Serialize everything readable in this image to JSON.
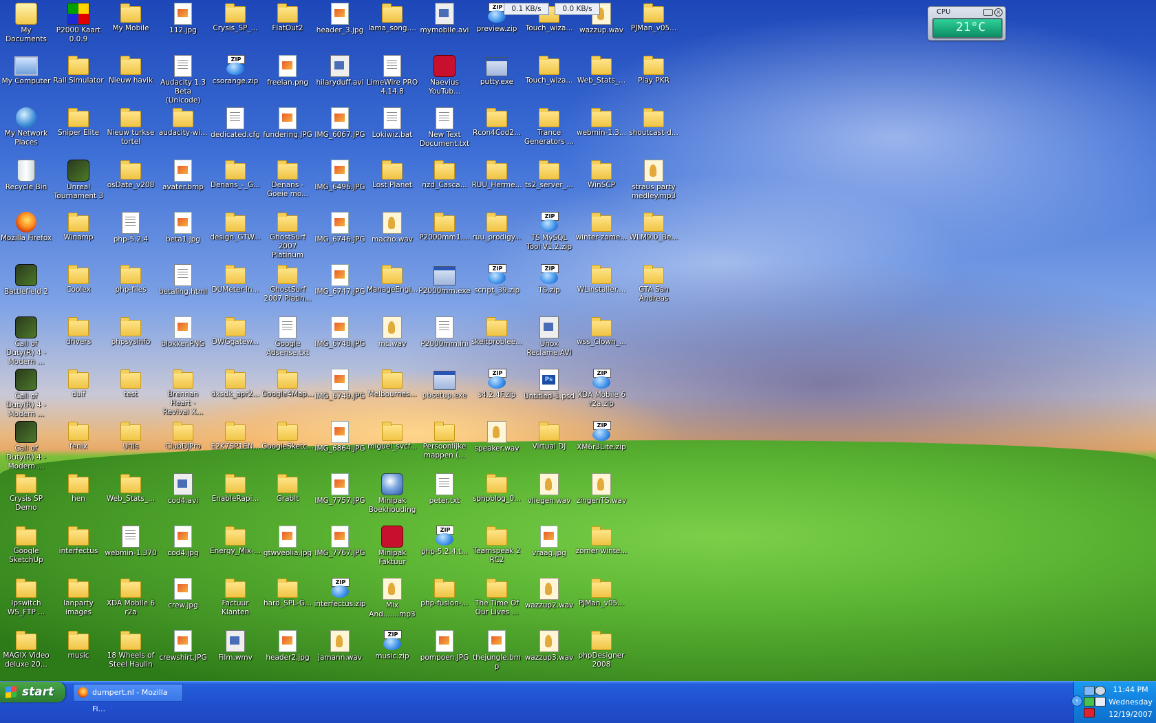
{
  "desktop": {
    "icons": [
      [
        "My Documents",
        "P2000 Kaart 0.0.9",
        "My Mobile",
        "112.jpg",
        "Crysis_SP_...",
        "FlatOut2",
        "header_3.jpg",
        "lama_song....",
        "mymobile.avi",
        "preview.zip",
        "Touch_wiza...",
        "wazzup.wav",
        "PJMan_v05..."
      ],
      [
        "My Computer",
        "Rail Simulator",
        "Nieuw havik",
        "Audacity 1.3 Beta (Unicode)",
        "csorange.zip",
        "freelan.png",
        "hilaryduff.avi",
        "LimeWire PRO 4.14.8",
        "Naevius YouTub...",
        "putty.exe",
        "Touch_wiza...",
        "Web_Stats_...",
        "Play PKR"
      ],
      [
        "My Network Places",
        "Sniper Elite",
        "Nieuw turkse tortel",
        "audacity-wi...",
        "dedicated.cfg",
        "fundering.JPG",
        "IMG_6067.JPG",
        "Lokiwiz.bat",
        "New Text Document.txt",
        "Rcon4Cod2...",
        "Trance Generators ...",
        "webmin-1.3...",
        "shoutcast-d..."
      ],
      [
        "Recycle Bin",
        "Unreal Tournament 3",
        "osDate_v208",
        "avater.bmp",
        "Denans_-_G...",
        "Denans - Goeie mo...",
        "IMG_6496.JPG",
        "Lost Planet",
        "nzd_Casca...",
        "RUU_Herme...",
        "ts2_server_...",
        "WinSCP",
        "straus party medley.mp3"
      ],
      [
        "Mozilla Firefox",
        "Winamp",
        "php-5.2.4",
        "beta1.jpg",
        "design_GTW...",
        "GhostSurf 2007 Platinum",
        "IMG_6746.JPG",
        "macho.wav",
        "P2000mm1....",
        "ruu_prodigy...",
        "TS MySQL Tool V1.2.zip",
        "winter-zome...",
        "WLM9.0_Be..."
      ],
      [
        "Battlefield 2",
        "Coolex",
        "php-files",
        "betaling.html",
        "DUMeter-In...",
        "GhostSurf 2007 Platin...",
        "IMG_6747.JPG",
        "ManageEngi...",
        "P2000mm.exe",
        "script_39.zip",
        "TS.zip",
        "WLinstaller....",
        "GTA San Andreas"
      ],
      [
        "Call of Duty(R) 4 - Modern ...",
        "drivers",
        "phpsysinfo",
        "blokker.PNG",
        "DWGgatew...",
        "Google Adsense.txt",
        "IMG_6748.JPG",
        "mc.wav",
        "P2000mm.ini",
        "skeitproblee...",
        "Unox Reclame.AVI",
        "wss_Clown_..."
      ],
      [
        "Call of Duty(R) 4 - Modern ...",
        "duif",
        "test",
        "Brennan Heart - Revival X...",
        "dxsdk_apr2...",
        "Google4Map...",
        "IMG_6749.JPG",
        "Melbournes...",
        "pbsetup.exe",
        "s4.2.4F.zip",
        "Untitled-1.psd",
        "XDA Mobile 6 r2a.zip"
      ],
      [
        "Call of Duty(R) 4 - Modern ...",
        "fenix",
        "Utils",
        "ClubDJPro",
        "E2K7SP1EN...",
        "GoogleSketc...",
        "IMG_6864.JPG",
        "miguel_svcf...",
        "Persoonlijke mappen (...",
        "speaker.wav",
        "Virtual DJ",
        "XM6r3Lite.zip"
      ],
      [
        "Crysis SP Demo",
        "hen",
        "Web_Stats_...",
        "cod4.avi",
        "EnableRapi...",
        "GrabIt",
        "IMG_7757.JPG",
        "Minipak Boekhouding",
        "peter.txt",
        "sphpblog_0...",
        "vliegen.wav",
        "zingenTS.wav"
      ],
      [
        "Google SketchUp",
        "interfectus",
        "webmin-1.370",
        "cod4.jpg",
        "Energy_Mix-...",
        "gtwveolia.jpg",
        "IMG_7767.JPG",
        "Minipak Faktuur",
        "php-5.2.4.t...",
        "Teamspeak 2 RC2",
        "vraag.jpg",
        "zomer-winte..."
      ],
      [
        "Ipswitch WS_FTP ...",
        "lanparty images",
        "XDA Mobile 6 r2a",
        "crew.jpg",
        "Factuur Klanten",
        "hard_SPL-G...",
        "interfectus.zip",
        "Mix And.......mp3",
        "php-fusion-...",
        "The Time Of Our Lives ...",
        "wazzup2.wav",
        "PJMan_v05..."
      ],
      [
        "MAGIX Video deluxe 20...",
        "music",
        "18 Wheels of Steel Haulin",
        "crewshirt.JPG",
        "Film.wmv",
        "header2.jpg",
        "jamann.wav",
        "music.zip",
        "pompoen.JPG",
        "thejungle.bmp",
        "wazzup3.wav",
        "phpDesigner 2008"
      ]
    ]
  },
  "netmeter": {
    "down": "0.1 KB/s",
    "up": "0.0 KB/s"
  },
  "cpu_gadget": {
    "title": "CPU",
    "value": "21°C"
  },
  "taskbar": {
    "start_label": "start",
    "task_label": "dumpert.nl - Mozilla Fi...",
    "clock_time": "11:44 PM",
    "clock_day": "Wednesday",
    "clock_date": "12/19/2007"
  }
}
